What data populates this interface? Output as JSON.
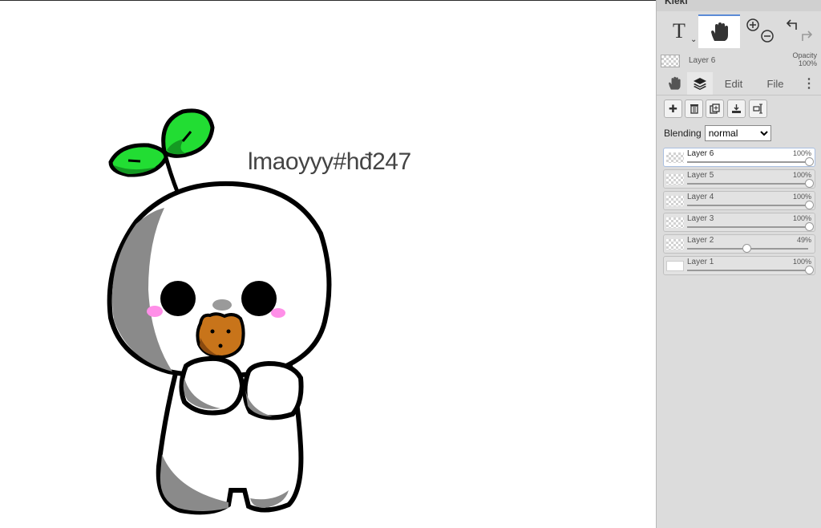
{
  "app": {
    "title": "Kleki"
  },
  "toolbar": {
    "text_tool_label": "T",
    "icons": [
      "text-tool-icon",
      "hand-tool-icon",
      "zoom-in-icon",
      "zoom-out-icon",
      "undo-icon",
      "redo-icon"
    ]
  },
  "current_layer": {
    "name": "Layer 6",
    "opacity_label": "Opacity",
    "opacity_value": "100%"
  },
  "tabs": {
    "edit": "Edit",
    "file": "File"
  },
  "layer_buttons": [
    "add-layer-icon",
    "delete-layer-icon",
    "duplicate-layer-icon",
    "merge-layer-icon",
    "rename-layer-icon"
  ],
  "blending": {
    "label": "Blending",
    "value": "normal"
  },
  "layers": [
    {
      "name": "Layer 6",
      "opacity": "100%",
      "level": 1.0
    },
    {
      "name": "Layer 5",
      "opacity": "100%",
      "level": 1.0
    },
    {
      "name": "Layer 4",
      "opacity": "100%",
      "level": 1.0
    },
    {
      "name": "Layer 3",
      "opacity": "100%",
      "level": 1.0
    },
    {
      "name": "Layer 2",
      "opacity": "49%",
      "level": 0.49
    },
    {
      "name": "Layer 1",
      "opacity": "100%",
      "level": 1.0
    }
  ],
  "canvas": {
    "text": "lmaoyyy#hđ247"
  },
  "colors": {
    "leaf": "#22dd33",
    "leaf_dark": "#149a22",
    "cookie": "#c8741a",
    "blush": "#ff8fe8",
    "shade": "#8a8a8a",
    "accent": "#5b8bd6"
  }
}
